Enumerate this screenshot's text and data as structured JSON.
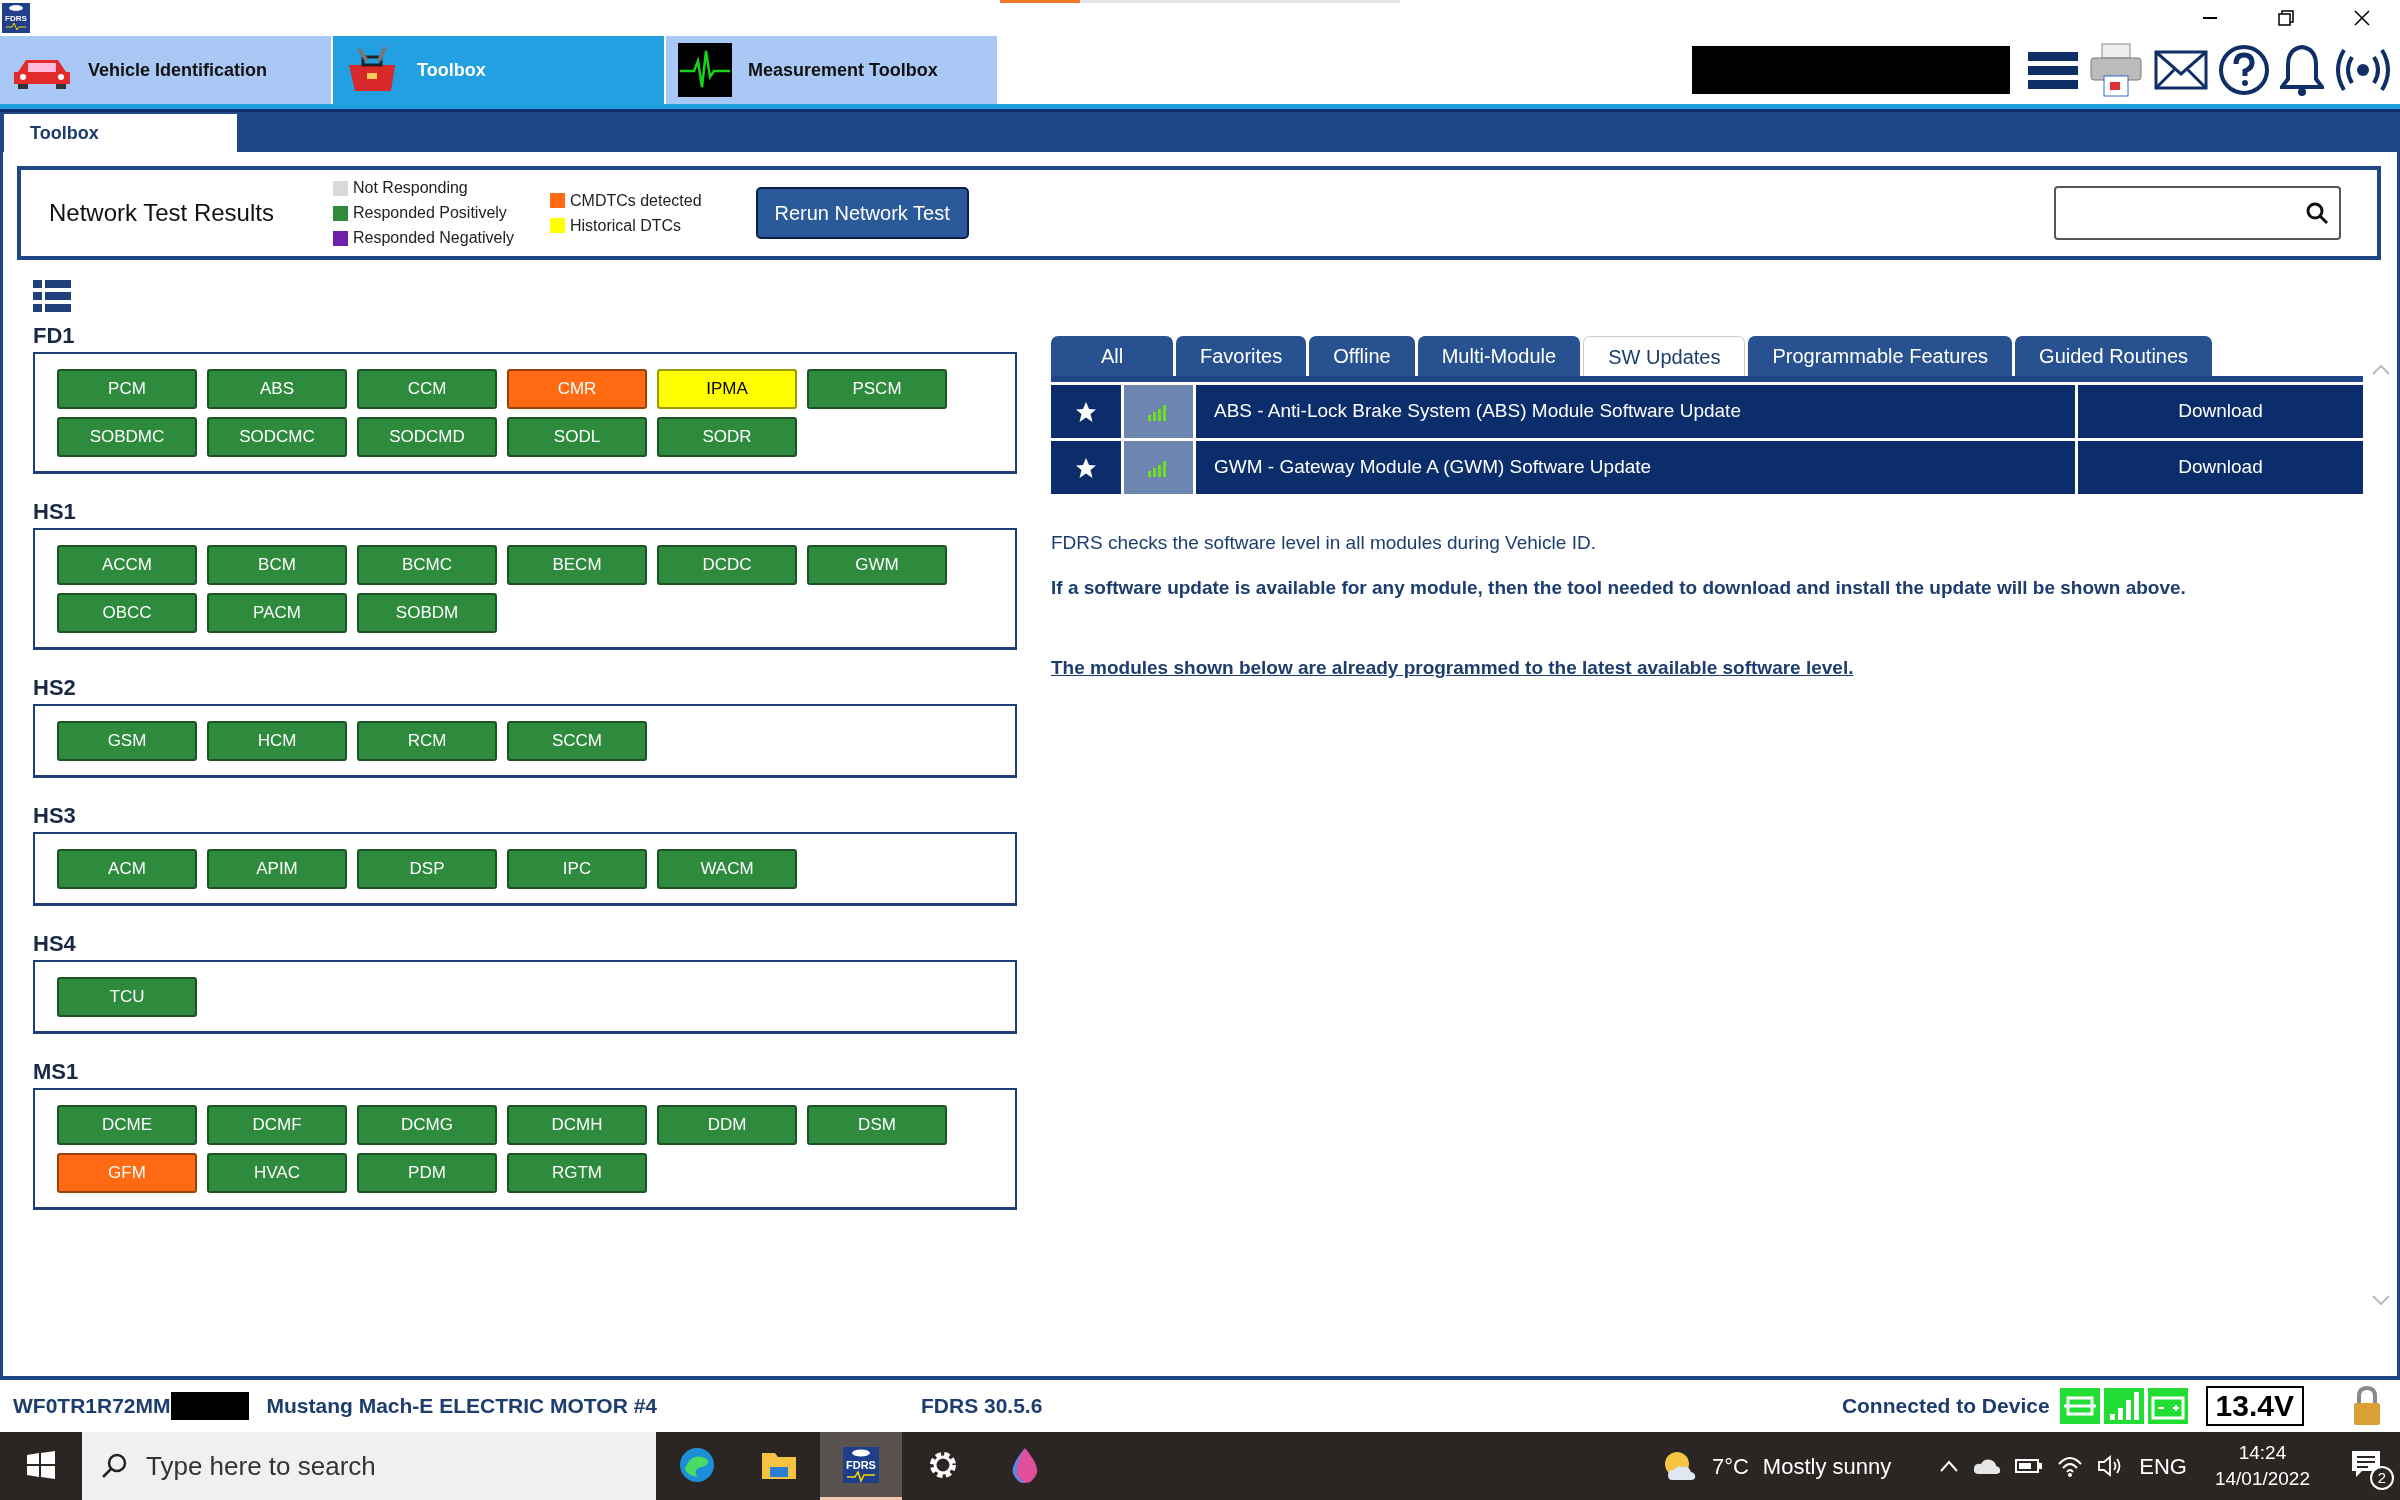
{
  "app": {
    "logo": "FDRS"
  },
  "nav_tabs": [
    {
      "label": "Vehicle Identification",
      "kind": "car",
      "selected": false
    },
    {
      "label": "Toolbox",
      "kind": "toolbox",
      "selected": true
    },
    {
      "label": "Measurement Toolbox",
      "kind": "scope",
      "selected": false
    }
  ],
  "page_tabs": [
    {
      "label": "Toolbox",
      "selected": true
    }
  ],
  "network_test": {
    "title": "Network Test Results",
    "legend": [
      {
        "label": "Not Responding",
        "color": "#d9d9d9"
      },
      {
        "label": "Responded Positively",
        "color": "#2e8b3e"
      },
      {
        "label": "Responded Negatively",
        "color": "#7020a8"
      },
      {
        "label": "CMDTCs detected",
        "color": "#ff6a13"
      },
      {
        "label": "Historical DTCs",
        "color": "#ffff00"
      }
    ],
    "rerun_button": "Rerun Network Test"
  },
  "networks": [
    {
      "name": "FD1",
      "modules": [
        {
          "label": "PCM",
          "color": "#2e8b3e"
        },
        {
          "label": "ABS",
          "color": "#2e8b3e"
        },
        {
          "label": "CCM",
          "color": "#2e8b3e"
        },
        {
          "label": "CMR",
          "color": "#ff6a13"
        },
        {
          "label": "IPMA",
          "color": "#ffff00"
        },
        {
          "label": "PSCM",
          "color": "#2e8b3e"
        },
        {
          "label": "SOBDMC",
          "color": "#2e8b3e"
        },
        {
          "label": "SODCMC",
          "color": "#2e8b3e"
        },
        {
          "label": "SODCMD",
          "color": "#2e8b3e"
        },
        {
          "label": "SODL",
          "color": "#2e8b3e"
        },
        {
          "label": "SODR",
          "color": "#2e8b3e"
        }
      ]
    },
    {
      "name": "HS1",
      "modules": [
        {
          "label": "ACCM",
          "color": "#2e8b3e"
        },
        {
          "label": "BCM",
          "color": "#2e8b3e"
        },
        {
          "label": "BCMC",
          "color": "#2e8b3e"
        },
        {
          "label": "BECM",
          "color": "#2e8b3e"
        },
        {
          "label": "DCDC",
          "color": "#2e8b3e"
        },
        {
          "label": "GWM",
          "color": "#2e8b3e"
        },
        {
          "label": "OBCC",
          "color": "#2e8b3e"
        },
        {
          "label": "PACM",
          "color": "#2e8b3e"
        },
        {
          "label": "SOBDM",
          "color": "#2e8b3e"
        }
      ]
    },
    {
      "name": "HS2",
      "modules": [
        {
          "label": "GSM",
          "color": "#2e8b3e"
        },
        {
          "label": "HCM",
          "color": "#2e8b3e"
        },
        {
          "label": "RCM",
          "color": "#2e8b3e"
        },
        {
          "label": "SCCM",
          "color": "#2e8b3e"
        }
      ]
    },
    {
      "name": "HS3",
      "modules": [
        {
          "label": "ACM",
          "color": "#2e8b3e"
        },
        {
          "label": "APIM",
          "color": "#2e8b3e"
        },
        {
          "label": "DSP",
          "color": "#2e8b3e"
        },
        {
          "label": "IPC",
          "color": "#2e8b3e"
        },
        {
          "label": "WACM",
          "color": "#2e8b3e"
        }
      ]
    },
    {
      "name": "HS4",
      "modules": [
        {
          "label": "TCU",
          "color": "#2e8b3e"
        }
      ]
    },
    {
      "name": "MS1",
      "modules": [
        {
          "label": "DCME",
          "color": "#2e8b3e"
        },
        {
          "label": "DCMF",
          "color": "#2e8b3e"
        },
        {
          "label": "DCMG",
          "color": "#2e8b3e"
        },
        {
          "label": "DCMH",
          "color": "#2e8b3e"
        },
        {
          "label": "DDM",
          "color": "#2e8b3e"
        },
        {
          "label": "DSM",
          "color": "#2e8b3e"
        },
        {
          "label": "GFM",
          "color": "#ff6a13"
        },
        {
          "label": "HVAC",
          "color": "#2e8b3e"
        },
        {
          "label": "PDM",
          "color": "#2e8b3e"
        },
        {
          "label": "RGTM",
          "color": "#2e8b3e"
        }
      ]
    }
  ],
  "module_tabs": [
    {
      "label": "All",
      "selected": false
    },
    {
      "label": "Favorites",
      "selected": false
    },
    {
      "label": "Offline",
      "selected": false
    },
    {
      "label": "Multi-Module",
      "selected": false
    },
    {
      "label": "SW Updates",
      "selected": true
    },
    {
      "label": "Programmable Features",
      "selected": false
    },
    {
      "label": "Guided Routines",
      "selected": false
    }
  ],
  "updates": [
    {
      "title": "ABS - Anti-Lock Brake System (ABS) Module Software Update",
      "action": "Download"
    },
    {
      "title": "GWM - Gateway Module A (GWM) Software Update",
      "action": "Download"
    }
  ],
  "info": {
    "note": "FDRS checks the software level in all modules during Vehicle ID.",
    "hint": "If a software update is available for any module, then the tool needed to download and install the update will be shown above.",
    "link": "The modules shown below are already programmed to the latest available software level."
  },
  "status_bar": {
    "vin": "WF0TR1R72MM",
    "vehicle": "Mustang Mach-E ELECTRIC MOTOR #4",
    "version": "FDRS 30.5.6",
    "connection": "Connected to Device",
    "voltage": "13.4V"
  },
  "taskbar": {
    "search": {
      "placeholder": "Type here to search"
    },
    "apps": [
      {
        "kind": "edge",
        "selected": false
      },
      {
        "kind": "folder",
        "selected": false
      },
      {
        "kind": "fdrs",
        "label": "FDRS",
        "selected": true
      },
      {
        "kind": "gear",
        "selected": false
      },
      {
        "kind": "drop",
        "selected": false
      }
    ],
    "temperature": "7°C",
    "weather": "Mostly sunny",
    "language": "ENG",
    "time": "14:24",
    "date": "14/01/2022",
    "notifications": "2"
  }
}
